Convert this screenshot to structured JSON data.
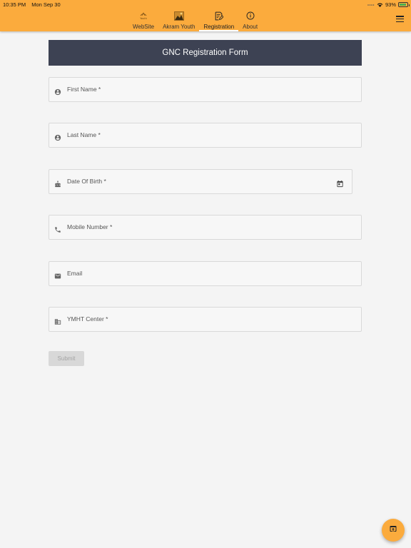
{
  "status_bar": {
    "time": "10:35 PM",
    "date": "Mon Sep 30",
    "battery": "93%"
  },
  "nav": {
    "tabs": [
      {
        "label": "WebSite",
        "icon": "youth-logo-icon",
        "active": false
      },
      {
        "label": "Akram Youth",
        "icon": "akram-youth-image-icon",
        "active": false
      },
      {
        "label": "Registration",
        "icon": "edit-document-icon",
        "active": true
      },
      {
        "label": "About",
        "icon": "info-icon",
        "active": false
      }
    ],
    "menu_icon": "hamburger-menu-icon"
  },
  "form": {
    "title": "GNC Registration Form",
    "fields": [
      {
        "label": "First Name *",
        "icon": "account-circle-icon"
      },
      {
        "label": "Last Name *",
        "icon": "account-circle-icon"
      },
      {
        "label": "Date Of Birth *",
        "icon": "cake-icon",
        "trailing_icon": "calendar-icon"
      },
      {
        "label": "Mobile Number *",
        "icon": "phone-icon"
      },
      {
        "label": "Email",
        "icon": "email-icon"
      },
      {
        "label": "YMHT Center *",
        "icon": "business-icon"
      }
    ],
    "submit_label": "Submit"
  },
  "fab": {
    "icon": "open-in-browser-icon"
  },
  "colors": {
    "accent": "#fbab3d",
    "header_bg": "#3d4253",
    "page_bg": "#f4f4f4",
    "field_border": "#d9d9d9",
    "disabled_button": "#d8d8d8"
  }
}
